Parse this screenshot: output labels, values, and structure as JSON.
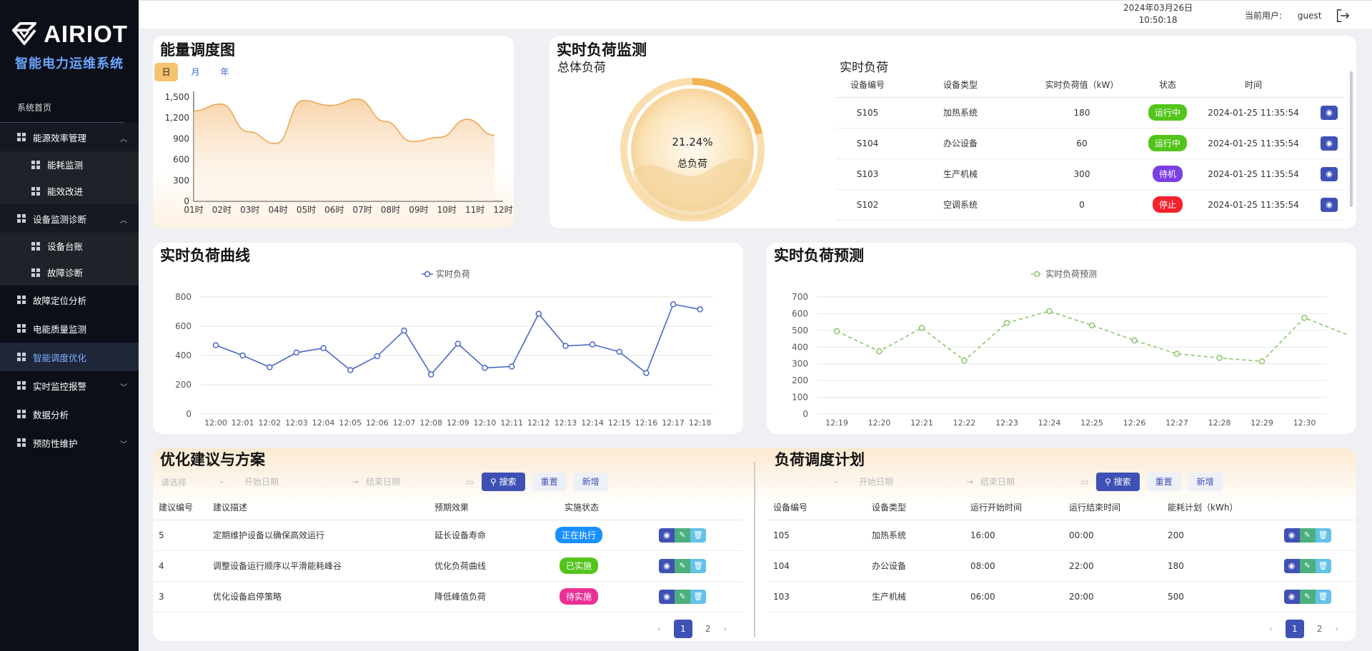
{
  "brand": {
    "name": "AIRIOT",
    "subtitle": "智能电力运维系统"
  },
  "sidebar": {
    "items": [
      {
        "label": "系统首页",
        "type": "sys"
      },
      {
        "label": "能源效率管理",
        "type": "group",
        "expanded": true
      },
      {
        "label": "能耗监测",
        "type": "sub"
      },
      {
        "label": "能效改进",
        "type": "sub"
      },
      {
        "label": "设备监测诊断",
        "type": "group",
        "expanded": true
      },
      {
        "label": "设备台账",
        "type": "sub"
      },
      {
        "label": "故障诊断",
        "type": "sub"
      },
      {
        "label": "故障定位分析",
        "type": "item"
      },
      {
        "label": "电能质量监测",
        "type": "item"
      },
      {
        "label": "智能调度优化",
        "type": "item",
        "active": true
      },
      {
        "label": "实时监控报警",
        "type": "item",
        "collapsible": true
      },
      {
        "label": "数据分析",
        "type": "item"
      },
      {
        "label": "预防性维护",
        "type": "item",
        "collapsible": true
      }
    ]
  },
  "header": {
    "date": "2024年03月26日",
    "time": "10:50:18",
    "user_label": "当前用户:",
    "user": "guest"
  },
  "energy": {
    "title": "能量调度图",
    "tabs": [
      "日",
      "月",
      "年"
    ],
    "active_tab": "日",
    "chart_data": {
      "type": "area",
      "x": [
        "01时",
        "02时",
        "03时",
        "04时",
        "05时",
        "06时",
        "07时",
        "08时",
        "09时",
        "10时",
        "11时",
        "12时"
      ],
      "values": [
        1300,
        1400,
        1000,
        830,
        1450,
        1380,
        1470,
        1150,
        860,
        920,
        1180,
        950
      ],
      "yticks": [
        "0",
        "300",
        "600",
        "900",
        "1,200",
        "1,500"
      ],
      "ylim": [
        0,
        1500
      ],
      "color": "#f0a24a"
    }
  },
  "monitor": {
    "title": "实时负荷监测",
    "total_label": "总体负荷",
    "gauge_value": "21.24%",
    "gauge_label": "总负荷",
    "gauge_fraction": 0.2124,
    "table_title": "实时负荷",
    "columns": [
      "设备编号",
      "设备类型",
      "实时负荷值（kW）",
      "状态",
      "时间"
    ],
    "rows": [
      {
        "id": "S105",
        "type": "加热系统",
        "load": "180",
        "status": "运行中",
        "status_color": "#52c41a",
        "time": "2024-01-25 11:35:54"
      },
      {
        "id": "S104",
        "type": "办公设备",
        "load": "60",
        "status": "运行中",
        "status_color": "#52c41a",
        "time": "2024-01-25 11:35:54"
      },
      {
        "id": "S103",
        "type": "生产机械",
        "load": "300",
        "status": "待机",
        "status_color": "#7b3fe4",
        "time": "2024-01-25 11:35:54"
      },
      {
        "id": "S102",
        "type": "空调系统",
        "load": "0",
        "status": "停止",
        "status_color": "#f5222d",
        "time": "2024-01-25 11:35:54"
      }
    ]
  },
  "curve": {
    "title": "实时负荷曲线",
    "chart_data": {
      "type": "line",
      "series": [
        {
          "name": "实时负荷",
          "values": [
            470,
            400,
            320,
            420,
            450,
            300,
            395,
            570,
            270,
            480,
            315,
            325,
            685,
            465,
            475,
            425,
            280,
            750,
            715
          ]
        }
      ],
      "x": [
        "12:00",
        "12:01",
        "12:02",
        "12:03",
        "12:04",
        "12:05",
        "12:06",
        "12:07",
        "12:08",
        "12:09",
        "12:10",
        "12:11",
        "12:12",
        "12:13",
        "12:14",
        "12:15",
        "12:16",
        "12:17",
        "12:18"
      ],
      "ylim": [
        0,
        800
      ],
      "yticks": [
        0,
        200,
        400,
        600,
        800
      ],
      "color": "#4a67c6"
    }
  },
  "forecast": {
    "title": "实时负荷预测",
    "chart_data": {
      "type": "line",
      "series": [
        {
          "name": "实时负荷预测",
          "values": [
            495,
            375,
            515,
            320,
            545,
            615,
            530,
            440,
            360,
            335,
            315,
            575,
            475
          ]
        }
      ],
      "x": [
        "12:19",
        "12:20",
        "12:21",
        "12:22",
        "12:23",
        "12:24",
        "12:25",
        "12:26",
        "12:27",
        "12:28",
        "12:29",
        "12:30",
        ""
      ],
      "ylim": [
        0,
        700
      ],
      "yticks": [
        0,
        100,
        200,
        300,
        400,
        500,
        600,
        700
      ],
      "color": "#8bc56a"
    }
  },
  "suggest": {
    "title": "优化建议与方案",
    "select_placeholder": "请选择",
    "start_placeholder": "开始日期",
    "end_placeholder": "结束日期",
    "search": "搜索",
    "reset": "重置",
    "add": "新增",
    "columns": [
      "建议编号",
      "建议描述",
      "预期效果",
      "实施状态"
    ],
    "rows": [
      {
        "id": "5",
        "desc": "定期维护设备以确保高效运行",
        "effect": "延长设备寿命",
        "status": "正在执行",
        "status_color": "#1890ff"
      },
      {
        "id": "4",
        "desc": "调整设备运行顺序以平滑能耗峰谷",
        "effect": "优化负荷曲线",
        "status": "已实施",
        "status_color": "#52c41a"
      },
      {
        "id": "3",
        "desc": "优化设备启停策略",
        "effect": "降低峰值负荷",
        "status": "待实施",
        "status_color": "#eb2f96"
      }
    ],
    "pages": [
      "1",
      "2"
    ]
  },
  "schedule": {
    "title": "负荷调度计划",
    "start_placeholder": "开始日期",
    "end_placeholder": "结束日期",
    "search": "搜索",
    "reset": "重置",
    "add": "新增",
    "columns": [
      "设备编号",
      "设备类型",
      "运行开始时间",
      "运行结束时间",
      "能耗计划（kWh）"
    ],
    "rows": [
      {
        "id": "105",
        "type": "加热系统",
        "start": "16:00",
        "end": "00:00",
        "plan": "200"
      },
      {
        "id": "104",
        "type": "办公设备",
        "start": "08:00",
        "end": "22:00",
        "plan": "180"
      },
      {
        "id": "103",
        "type": "生产机械",
        "start": "06:00",
        "end": "20:00",
        "plan": "500"
      }
    ],
    "pages": [
      "1",
      "2"
    ]
  }
}
